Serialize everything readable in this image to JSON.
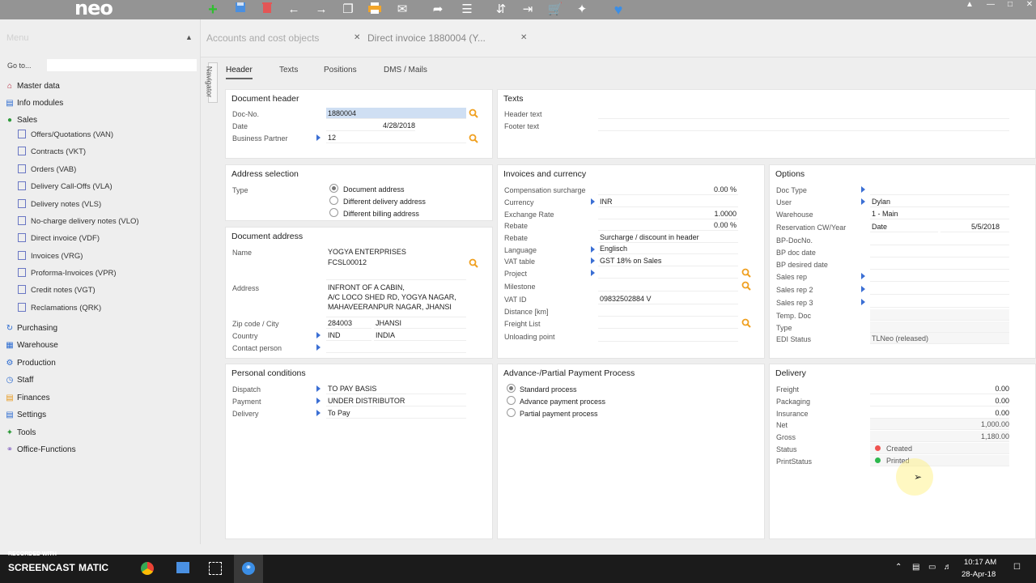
{
  "app": {
    "logo": "neo"
  },
  "toolbar": {
    "icons": [
      "add-icon",
      "save-icon",
      "delete-icon",
      "back-icon",
      "forward-icon",
      "copy-icon",
      "print-icon",
      "mail-icon",
      "share-icon",
      "list-icon",
      "transfer-icon",
      "export-icon",
      "cart-icon",
      "network-icon",
      "heart-icon"
    ]
  },
  "menu": {
    "title": "Menu",
    "goto_label": "Go to...",
    "items": [
      {
        "label": "Master data"
      },
      {
        "label": "Info modules"
      },
      {
        "label": "Sales"
      },
      {
        "label": "Purchasing"
      },
      {
        "label": "Warehouse"
      },
      {
        "label": "Production"
      },
      {
        "label": "Staff"
      },
      {
        "label": "Finances"
      },
      {
        "label": "Settings"
      },
      {
        "label": "Tools"
      },
      {
        "label": "Office-Functions"
      }
    ],
    "sales_sub": [
      "Offers/Quotations (VAN)",
      "Contracts (VKT)",
      "Orders (VAB)",
      "Delivery Call-Offs (VLA)",
      "Delivery notes (VLS)",
      "No-charge delivery notes (VLO)",
      "Direct invoice (VDF)",
      "Invoices (VRG)",
      "Proforma-Invoices (VPR)",
      "Credit notes (VGT)",
      "Reclamations (QRK)"
    ]
  },
  "tabs": {
    "tab1": "Accounts and cost objects",
    "tab2": "Direct invoice 1880004 (Y..."
  },
  "navigator": "Navigator",
  "subtabs": [
    "Header",
    "Texts",
    "Positions",
    "DMS / Mails"
  ],
  "doc_header": {
    "title": "Document header",
    "docno_label": "Doc-No.",
    "docno": "1880004",
    "date_label": "Date",
    "date": "4/28/2018",
    "bp_label": "Business Partner",
    "bp": "12"
  },
  "texts": {
    "title": "Texts",
    "header_label": "Header text",
    "footer_label": "Footer text"
  },
  "address_selection": {
    "title": "Address selection",
    "type_label": "Type",
    "options": [
      "Document address",
      "Different delivery address",
      "Different billing address"
    ]
  },
  "doc_address": {
    "title": "Document address",
    "name_label": "Name",
    "name1": "YOGYA ENTERPRISES",
    "name2": "FCSL00012",
    "address_label": "Address",
    "addr1": "INFRONT OF A CABIN,",
    "addr2": "A/C LOCO SHED RD, YOGYA NAGAR,",
    "addr3": "MAHAVEERANPUR NAGAR, JHANSI",
    "zip_label": "Zip code / City",
    "zip": "284003",
    "city": "JHANSI",
    "country_label": "Country",
    "country_code": "IND",
    "country": "INDIA",
    "contact_label": "Contact person"
  },
  "invoices": {
    "title": "Invoices and currency",
    "comp_label": "Compensation surcharge",
    "comp": "0.00 %",
    "currency_label": "Currency",
    "currency": "INR",
    "exrate_label": "Exchange Rate",
    "exrate": "1.0000",
    "rebate1_label": "Rebate",
    "rebate1": "0.00 %",
    "rebate2_label": "Rebate",
    "rebate2": "Surcharge / discount in header",
    "language_label": "Language",
    "language": "Englisch",
    "vat_label": "VAT table",
    "vat": "GST 18% on Sales",
    "project_label": "Project",
    "milestone_label": "Milestone",
    "vatid_label": "VAT ID",
    "vatid": "09832502884 V",
    "distance_label": "Distance [km]",
    "freight_label": "Freight List",
    "unloading_label": "Unloading point"
  },
  "options": {
    "title": "Options",
    "doctype_label": "Doc Type",
    "user_label": "User",
    "user": "Dylan",
    "warehouse_label": "Warehouse",
    "warehouse": "1 - Main",
    "reservation_label": "Reservation CW/Year",
    "reservation_type": "Date",
    "reservation_date": "5/5/2018",
    "bpdocno_label": "BP-DocNo.",
    "bpdocdate_label": "BP doc date",
    "bpdesired_label": "BP desired date",
    "salesrep_label": "Sales rep",
    "salesrep2_label": "Sales rep 2",
    "salesrep3_label": "Sales rep 3",
    "tempdoc_label": "Temp. Doc",
    "type_label": "Type",
    "edi_label": "EDI Status",
    "edi": "TLNeo (released)"
  },
  "personal": {
    "title": "Personal conditions",
    "dispatch_label": "Dispatch",
    "dispatch": "TO PAY BASIS",
    "payment_label": "Payment",
    "payment": "UNDER DISTRIBUTOR",
    "delivery_label": "Delivery",
    "delivery": "To Pay"
  },
  "advance": {
    "title": "Advance-/Partial Payment Process",
    "options": [
      "Standard process",
      "Advance payment process",
      "Partial payment process"
    ]
  },
  "delivery": {
    "title": "Delivery",
    "freight_label": "Freight",
    "freight": "0.00",
    "packaging_label": "Packaging",
    "packaging": "0.00",
    "insurance_label": "Insurance",
    "insurance": "0.00",
    "net_label": "Net",
    "net": "1,000.00",
    "gross_label": "Gross",
    "gross": "1,180.00",
    "status_label": "Status",
    "status": "Created",
    "status_color": "#ef5350",
    "printstatus_label": "PrintStatus",
    "printstatus": "Printed",
    "printstatus_color": "#2db84d"
  },
  "taskbar": {
    "recorded": "RECORDED WITH",
    "brand": "SCREENCAST",
    "brand2": "MATIC",
    "time": "10:17 AM",
    "date": "28-Apr-18"
  }
}
